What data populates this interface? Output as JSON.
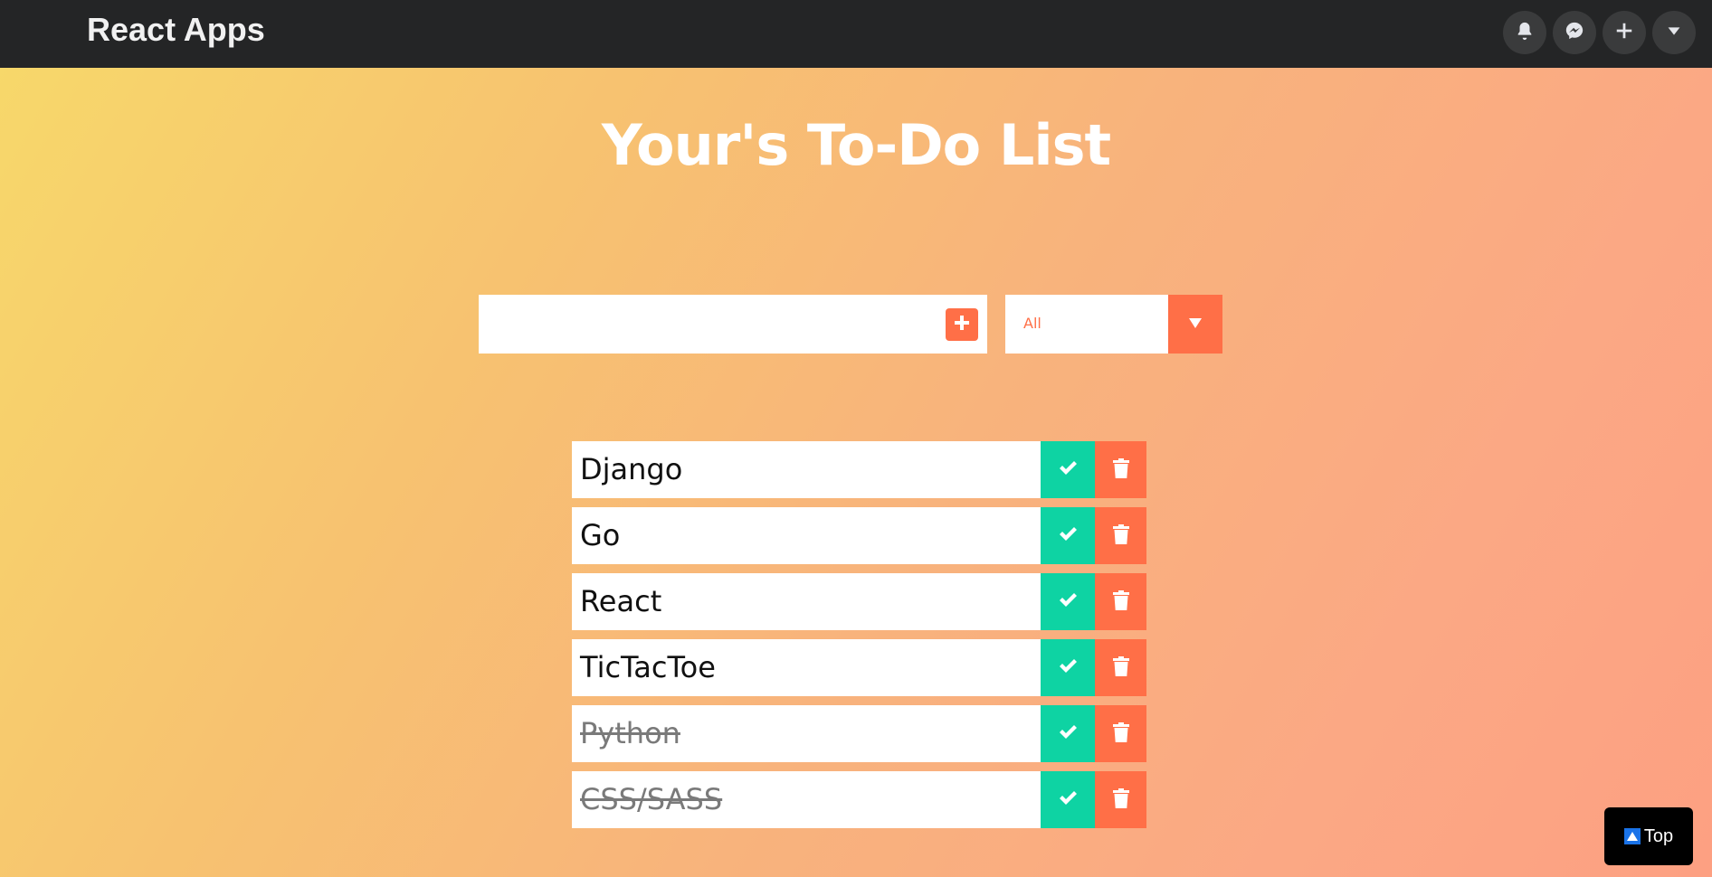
{
  "navbar": {
    "brand": "React Apps",
    "icons": [
      "notifications-icon",
      "messenger-icon",
      "create-icon",
      "account-menu-icon"
    ]
  },
  "main": {
    "title": "Your's To-Do List"
  },
  "form": {
    "input_value": "",
    "input_placeholder": "",
    "add_icon": "plus-square-icon",
    "filter_selected": "All"
  },
  "todos": [
    {
      "text": "Django",
      "completed": false
    },
    {
      "text": "Go",
      "completed": false
    },
    {
      "text": "React",
      "completed": false
    },
    {
      "text": "TicTacToe",
      "completed": false
    },
    {
      "text": "Python",
      "completed": true
    },
    {
      "text": "CSS/SASS",
      "completed": true
    }
  ],
  "scroll_top": {
    "label": "Top"
  },
  "colors": {
    "accent": "#ff6f47",
    "complete": "#0ed3a3",
    "navbar": "#242526"
  }
}
